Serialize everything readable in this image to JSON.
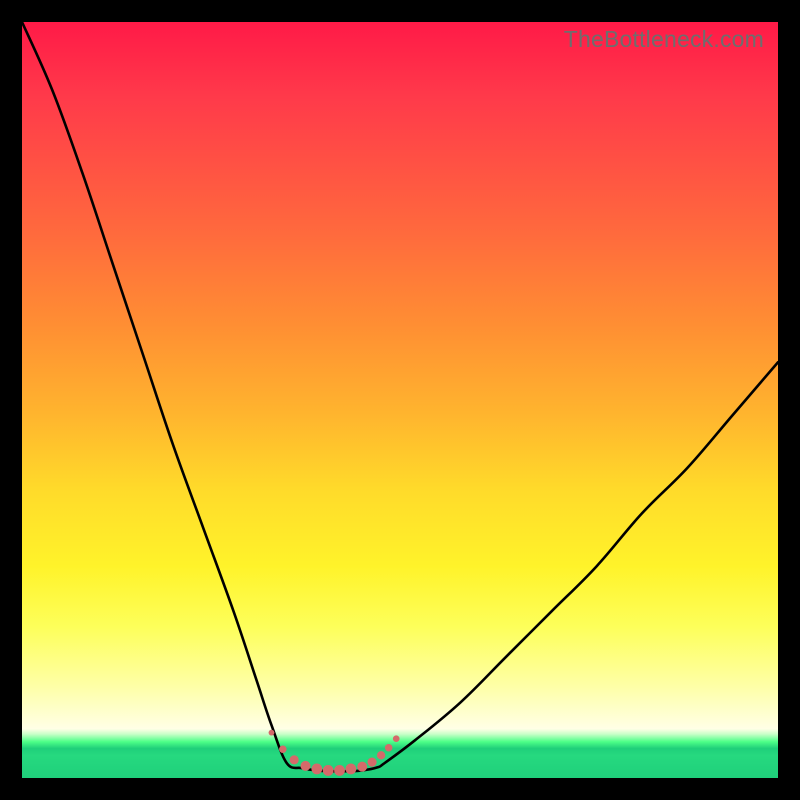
{
  "watermark": "TheBottleneck.com",
  "colors": {
    "frame": "#000000",
    "curve": "#000000",
    "marker_fill": "#d46a6a",
    "marker_stroke": "#c85a5a"
  },
  "chart_data": {
    "type": "line",
    "title": "",
    "xlabel": "",
    "ylabel": "",
    "xlim": [
      0,
      100
    ],
    "ylim": [
      0,
      100
    ],
    "note": "V-shaped bottleneck curve. Y≈0 is optimal (green band). Valley flat at ~y=2 over x≈35–48. Left arm rises steeply toward y=100 at x≈0; right arm rises to y≈55 at x=100.",
    "series": [
      {
        "name": "left-arm",
        "x": [
          0,
          4,
          8,
          12,
          16,
          20,
          24,
          28,
          31,
          33,
          35
        ],
        "y": [
          100,
          91,
          80,
          68,
          56,
          44,
          33,
          22,
          13,
          7,
          2
        ]
      },
      {
        "name": "valley",
        "x": [
          35,
          37,
          39,
          41,
          43,
          45,
          47,
          48
        ],
        "y": [
          2,
          1.3,
          1.0,
          0.9,
          0.9,
          1.0,
          1.4,
          2
        ]
      },
      {
        "name": "right-arm",
        "x": [
          48,
          52,
          58,
          64,
          70,
          76,
          82,
          88,
          94,
          100
        ],
        "y": [
          2,
          5,
          10,
          16,
          22,
          28,
          35,
          41,
          48,
          55
        ]
      }
    ],
    "markers": {
      "name": "valley-markers",
      "note": "Pink dot overlay along valley floor, denser & larger near middle, shallow U shape.",
      "points": [
        {
          "x": 33.0,
          "y": 6.0,
          "r": 0.7
        },
        {
          "x": 34.5,
          "y": 3.8,
          "r": 0.9
        },
        {
          "x": 36.0,
          "y": 2.4,
          "r": 1.1
        },
        {
          "x": 37.5,
          "y": 1.6,
          "r": 1.2
        },
        {
          "x": 39.0,
          "y": 1.2,
          "r": 1.3
        },
        {
          "x": 40.5,
          "y": 1.0,
          "r": 1.3
        },
        {
          "x": 42.0,
          "y": 1.0,
          "r": 1.3
        },
        {
          "x": 43.5,
          "y": 1.2,
          "r": 1.3
        },
        {
          "x": 45.0,
          "y": 1.5,
          "r": 1.2
        },
        {
          "x": 46.3,
          "y": 2.1,
          "r": 1.1
        },
        {
          "x": 47.5,
          "y": 3.0,
          "r": 1.0
        },
        {
          "x": 48.5,
          "y": 4.0,
          "r": 0.9
        },
        {
          "x": 49.5,
          "y": 5.2,
          "r": 0.8
        }
      ]
    }
  }
}
